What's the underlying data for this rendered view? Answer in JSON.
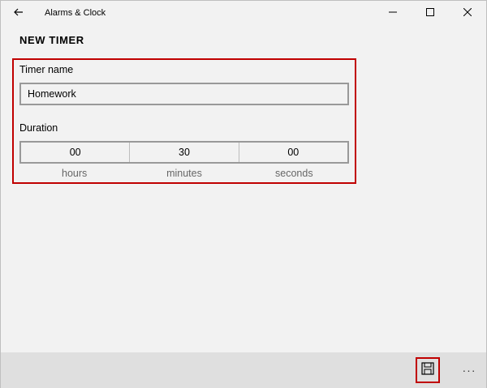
{
  "window": {
    "app_title": "Alarms & Clock",
    "icons": [
      "back-arrow-icon",
      "minimize-icon",
      "maximize-icon",
      "close-icon"
    ]
  },
  "page": {
    "title": "NEW TIMER"
  },
  "form": {
    "name_label": "Timer name",
    "name_value": "Homework",
    "duration_label": "Duration",
    "duration": {
      "hours": "00",
      "minutes": "30",
      "seconds": "00"
    },
    "units": {
      "hours": "hours",
      "minutes": "minutes",
      "seconds": "seconds"
    }
  },
  "command_bar": {
    "save_icon": "save-disk-icon",
    "more_label": "···"
  },
  "colors": {
    "highlight": "#c00000",
    "background": "#f2f2f2",
    "command_bar": "#dfdfdf"
  }
}
